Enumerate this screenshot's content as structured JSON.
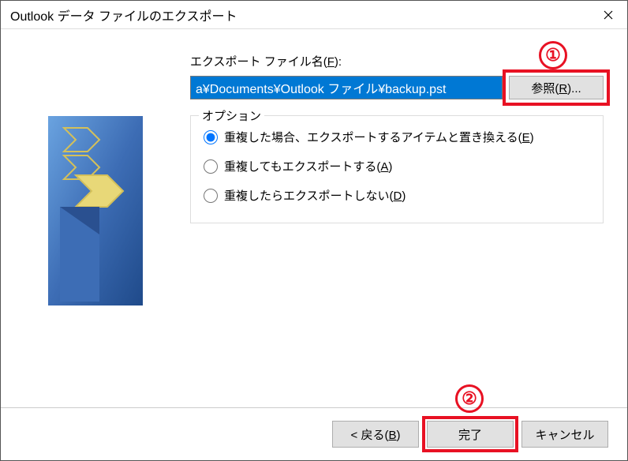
{
  "window": {
    "title": "Outlook データ ファイルのエクスポート"
  },
  "filename": {
    "label_pre": "エクスポート ファイル名(",
    "label_key": "F",
    "label_post": "):",
    "value": "a¥Documents¥Outlook ファイル¥backup.pst",
    "browse_pre": "参照(",
    "browse_key": "R",
    "browse_post": ")..."
  },
  "options": {
    "legend": "オプション",
    "items": [
      {
        "pre": "重複した場合、エクスポートするアイテムと置き換える(",
        "key": "E",
        "post": ")",
        "checked": true
      },
      {
        "pre": "重複してもエクスポートする(",
        "key": "A",
        "post": ")",
        "checked": false
      },
      {
        "pre": "重複したらエクスポートしない(",
        "key": "D",
        "post": ")",
        "checked": false
      }
    ]
  },
  "footer": {
    "back_pre": "< 戻る(",
    "back_key": "B",
    "back_post": ")",
    "finish": "完了",
    "cancel": "キャンセル"
  },
  "annotations": {
    "one": "①",
    "two": "②"
  }
}
